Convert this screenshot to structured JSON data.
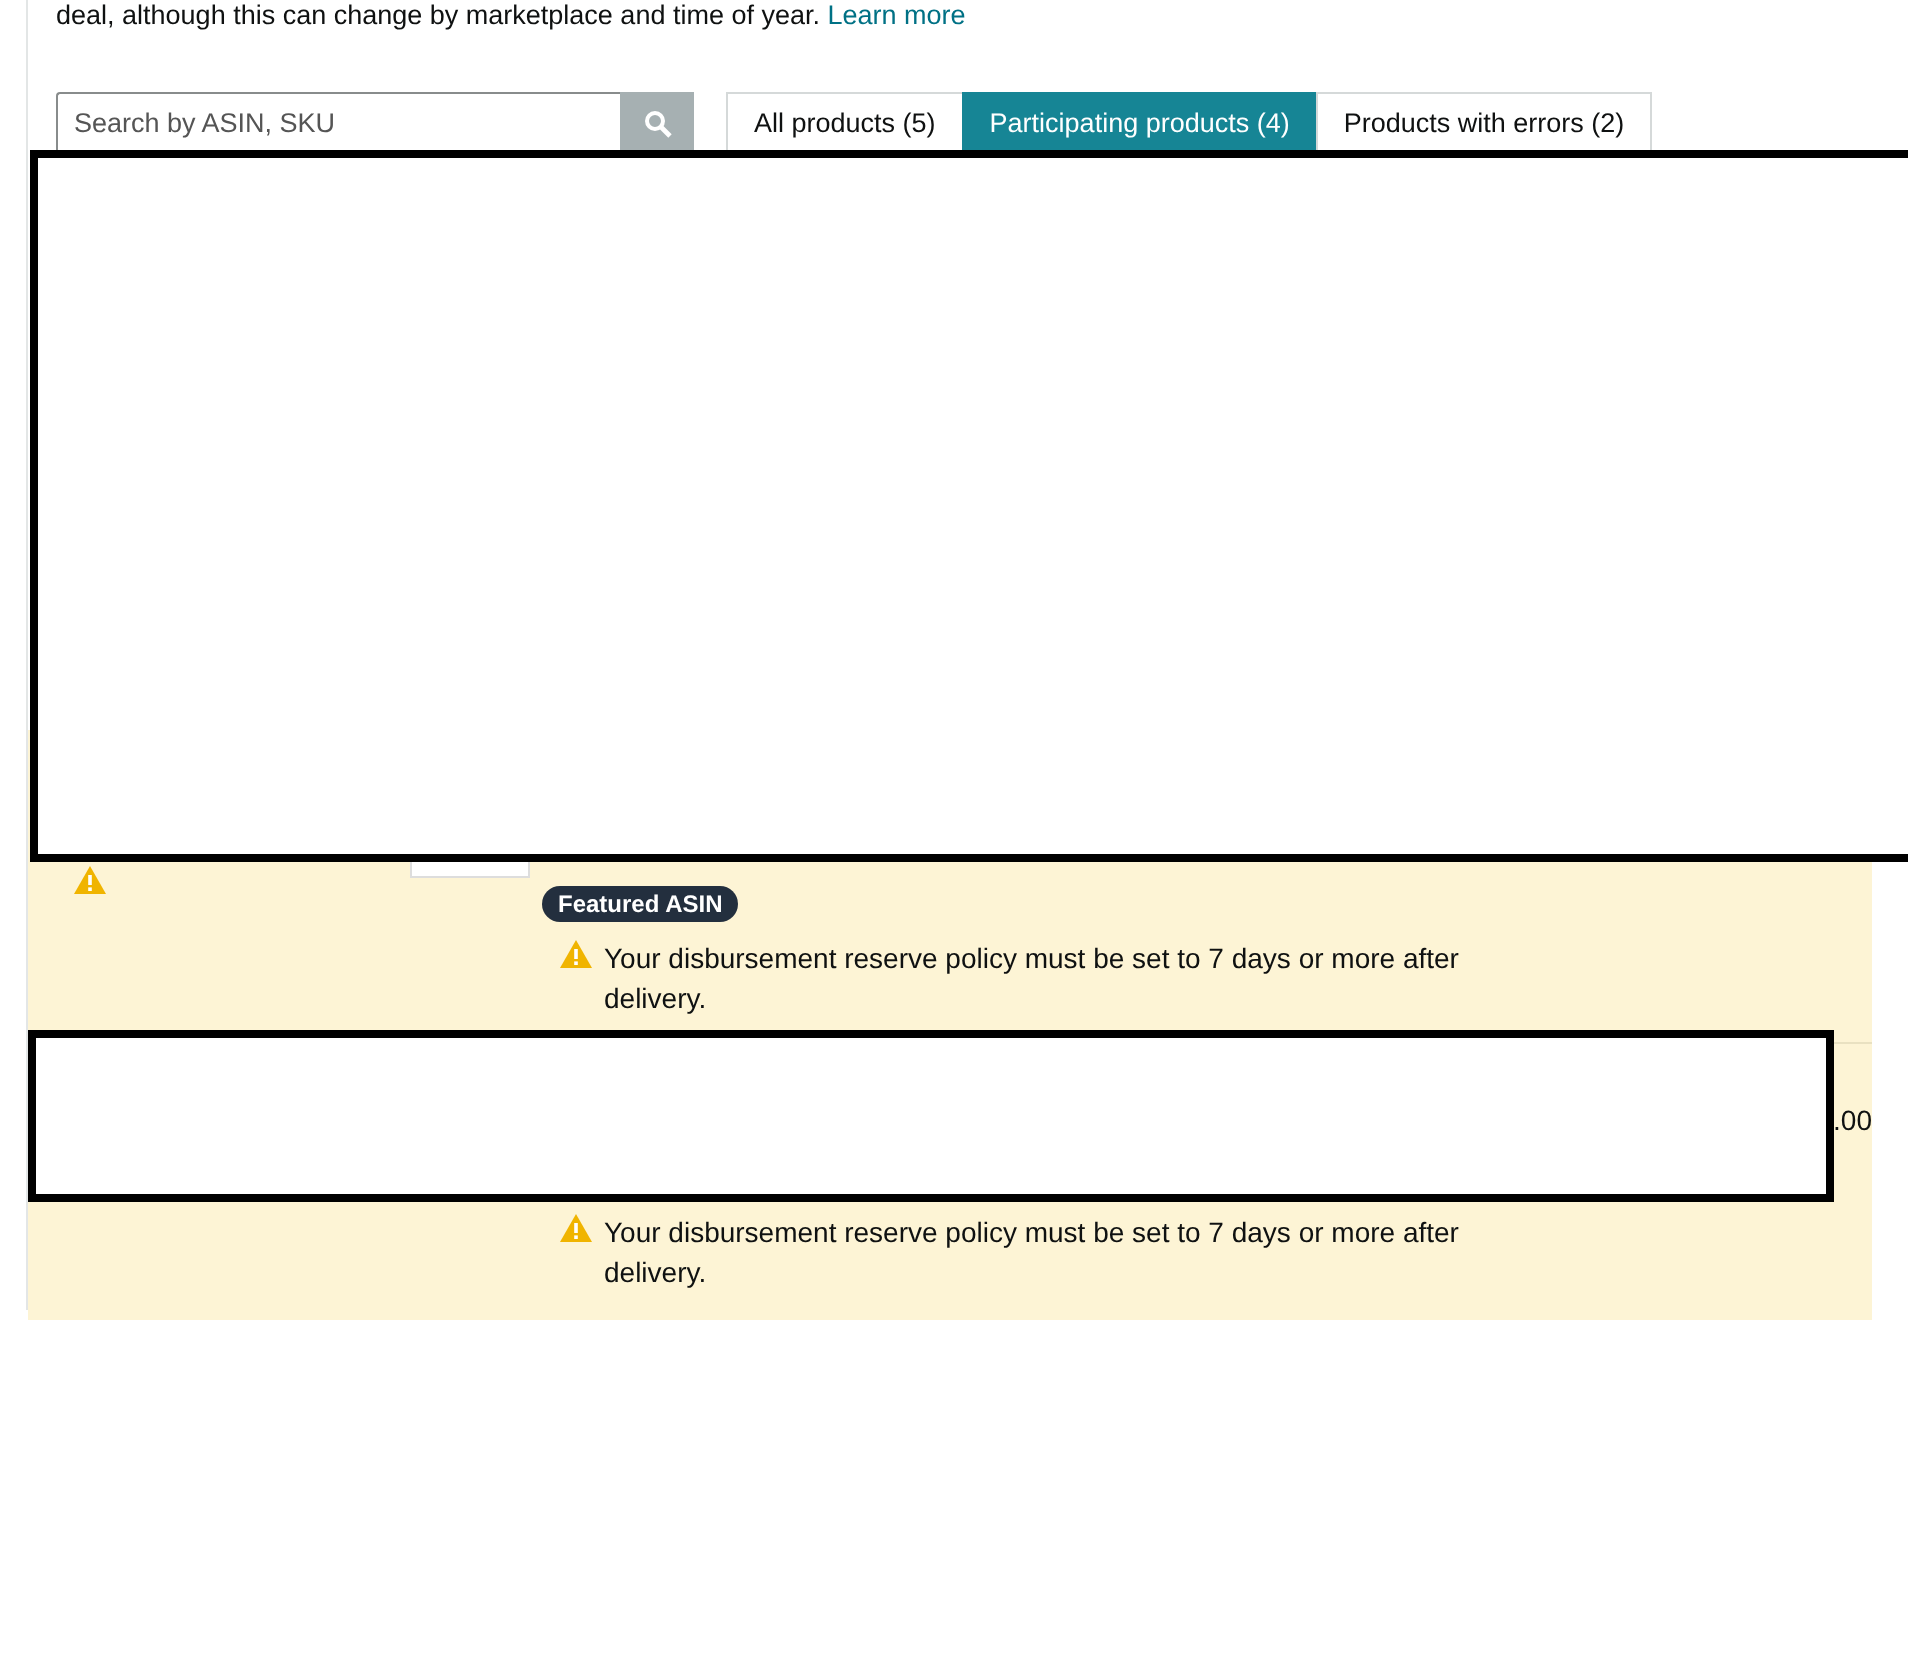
{
  "intro": {
    "text": "deal, although this can change by marketplace and time of year.",
    "link": "Learn more"
  },
  "search": {
    "placeholder": "Search by ASIN, SKU"
  },
  "tabs": [
    {
      "label": "All products (5)",
      "selected": false
    },
    {
      "label": "Participating products (4)",
      "selected": true
    },
    {
      "label": "Products with errors (2)",
      "selected": false
    }
  ],
  "rows": [
    {
      "badge": "Featured ASIN",
      "warning": "Your disbursement reserve policy must be set to 7 days or more after delivery."
    },
    {
      "price": ".00",
      "warning": "Your disbursement reserve policy must be set to 7 days or more after delivery."
    }
  ]
}
